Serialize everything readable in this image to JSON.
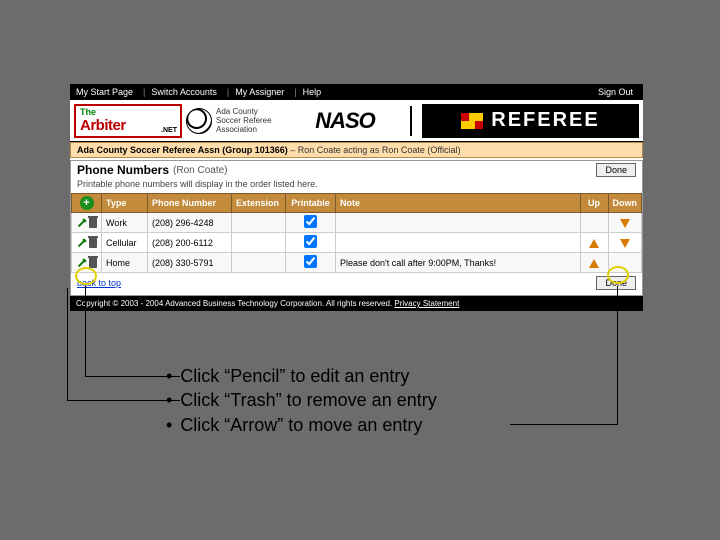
{
  "nav": {
    "items": [
      "My Start Page",
      "Switch Accounts",
      "My Assigner",
      "Help"
    ],
    "signout": "Sign Out"
  },
  "logos": {
    "arbiter_the": "The",
    "arbiter_name": "Arbiter",
    "arbiter_net": ".NET",
    "ada_text": "Ada County\nSoccer Referee\nAssociation",
    "naso": "NASO",
    "referee": "REFEREE"
  },
  "context": {
    "org": "Ada County Soccer Referee Assn (Group 101366)",
    "sep": " – ",
    "acting": "Ron Coate acting as Ron Coate (Official)"
  },
  "section": {
    "title": "Phone Numbers",
    "user": "(Ron Coate)",
    "subtitle": "Printable phone numbers will display in the order listed here.",
    "done": "Done"
  },
  "table": {
    "headers": {
      "add": "+",
      "type": "Type",
      "phone": "Phone Number",
      "ext": "Extension",
      "print": "Printable",
      "note": "Note",
      "up": "Up",
      "down": "Down"
    },
    "rows": [
      {
        "type": "Work",
        "phone": "(208) 296-4248",
        "ext": "",
        "print": true,
        "note": "",
        "up": false,
        "down": true
      },
      {
        "type": "Cellular",
        "phone": "(208) 200-6112",
        "ext": "",
        "print": true,
        "note": "",
        "up": true,
        "down": true
      },
      {
        "type": "Home",
        "phone": "(208) 330-5791",
        "ext": "",
        "print": true,
        "note": "Please don't call after 9:00PM, Thanks!",
        "up": true,
        "down": false
      }
    ]
  },
  "footer": {
    "backtotop": "back to top",
    "done": "Done",
    "copyright": "Copyright © 2003 - 2004 Advanced Business Technology Corporation. All rights reserved. ",
    "privacy": "Privacy Statement"
  },
  "instructions": {
    "lines": [
      "Click “Pencil” to edit an entry",
      "Click “Trash” to remove an entry",
      "Click “Arrow” to move an entry"
    ]
  }
}
